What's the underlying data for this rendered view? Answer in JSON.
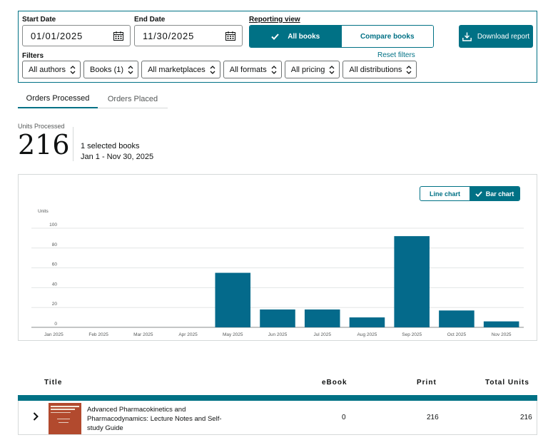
{
  "filters_panel": {
    "start_date_label": "Start Date",
    "start_date_value": "01/01/2025",
    "end_date_label": "End Date",
    "end_date_value": "11/30/2025",
    "reporting_view_label": "Reporting view",
    "view_all_books": "All books",
    "view_compare_books": "Compare books",
    "download_label": "Download report",
    "filters_label": "Filters",
    "reset_label": "Reset filters",
    "dropdowns": {
      "authors": "All authors",
      "books": "Books (1)",
      "marketplaces": "All marketplaces",
      "formats": "All formats",
      "pricing": "All pricing",
      "distributions": "All distributions"
    }
  },
  "tabs": {
    "processed": "Orders Processed",
    "placed": "Orders Placed"
  },
  "summary": {
    "units_label": "Units Processed",
    "units_value": "216",
    "selected_books": "1 selected books",
    "date_range": "Jan 1 - Nov 30, 2025"
  },
  "chart_controls": {
    "line_label": "Line chart",
    "bar_label": "Bar chart"
  },
  "chart_data": {
    "type": "bar",
    "ylabel": "Units",
    "ylim": [
      0,
      100
    ],
    "yticks": [
      0,
      20,
      40,
      60,
      80,
      100
    ],
    "grid": true,
    "categories": [
      "Jan 2025",
      "Feb 2025",
      "Mar 2025",
      "Apr 2025",
      "May 2025",
      "Jun 2025",
      "Jul 2025",
      "Aug 2025",
      "Sep 2025",
      "Oct 2025",
      "Nov 2025"
    ],
    "values": [
      0,
      0,
      0,
      0,
      55,
      18,
      18,
      10,
      92,
      17,
      6
    ],
    "bar_color": "#046a8b"
  },
  "table": {
    "headers": {
      "title": "Title",
      "ebook": "eBook",
      "print": "Print",
      "total": "Total Units"
    },
    "rows": [
      {
        "title": "Advanced Pharmacokinetics and Pharmacodynamics: Lecture Notes and Self-study Guide",
        "ebook": "0",
        "print": "216",
        "total": "216"
      }
    ]
  },
  "colors": {
    "accent": "#007185",
    "bar": "#046a8b",
    "cover": "#b24a2e"
  }
}
